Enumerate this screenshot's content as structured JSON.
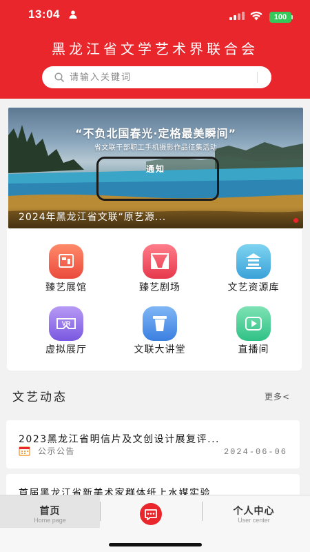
{
  "status_bar": {
    "time": "13:04",
    "battery": "100"
  },
  "header": {
    "title": "黑龙江省文学艺术界联合会",
    "search_placeholder": "请输入关键词",
    "search_button": "搜索"
  },
  "banner": {
    "headline": "“不负北国春光·定格最美瞬间”",
    "subline": "省文联干部职工手机摄影作品征集活动",
    "notice": "通知",
    "caption": "2024年黑龙江省文联“原艺源...",
    "indicator_color": "#e8262c"
  },
  "grid": {
    "items": [
      {
        "label": "臻艺展馆",
        "icon": "gallery-icon",
        "color_top": "#ff8a6a",
        "color_bottom": "#ea4a3c"
      },
      {
        "label": "臻艺剧场",
        "icon": "theater-icon",
        "color_top": "#ff7d8a",
        "color_bottom": "#e6384c"
      },
      {
        "label": "文艺资源库",
        "icon": "library-icon",
        "color_top": "#7ed3f0",
        "color_bottom": "#3aa2d8"
      },
      {
        "label": "虚拟展厅",
        "icon": "vr-icon",
        "color_top": "#b79af5",
        "color_bottom": "#7a58e0"
      },
      {
        "label": "文联大讲堂",
        "icon": "lecture-icon",
        "color_top": "#7fb6f5",
        "color_bottom": "#3b7fe0"
      },
      {
        "label": "直播间",
        "icon": "live-icon",
        "color_top": "#7ee2b4",
        "color_bottom": "#2fc186"
      }
    ]
  },
  "news": {
    "section_title": "文艺动态",
    "more_label": "更多<",
    "items": [
      {
        "title": "2023黑龙江省明信片及文创设计展复评...",
        "category": "公示公告",
        "date": "2024-06-06"
      },
      {
        "title": "首届黑龙江省新美术家群体纸上水媒实验..."
      }
    ]
  },
  "tab_bar": {
    "home_label": "首页",
    "home_sub": "Home page",
    "user_label": "个人中心",
    "user_sub": "User center"
  }
}
